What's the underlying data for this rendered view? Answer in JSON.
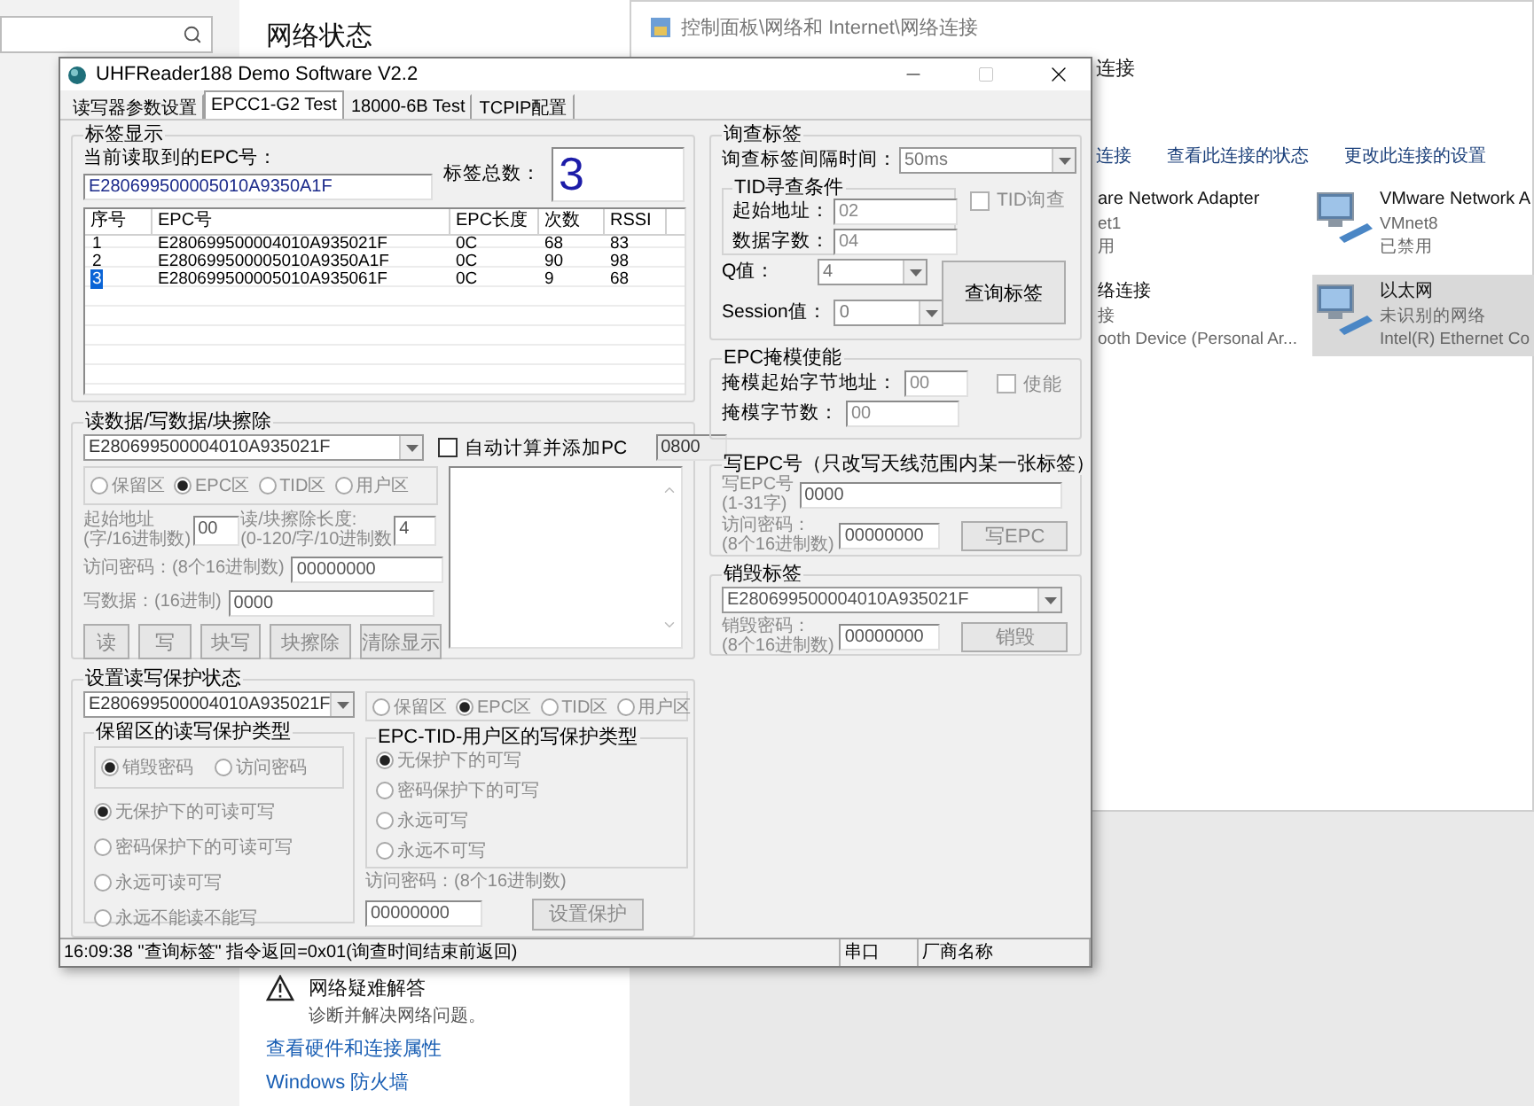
{
  "settings_window": {
    "heading": "网络状态",
    "troubleshoot": {
      "title": "网络疑难解答",
      "subtitle": "诊断并解决网络问题。"
    },
    "links": [
      "查看硬件和连接属性",
      "Windows 防火墙"
    ]
  },
  "network_window": {
    "path": "控制面板\\网络和 Internet\\网络连接",
    "address_tail": "连接",
    "toolbar": [
      "连接",
      "查看此连接的状态",
      "更改此连接的设置"
    ],
    "adapters": [
      {
        "lines": [
          "are Network Adapter",
          "et1",
          "用"
        ],
        "selected": false
      },
      {
        "lines": [
          "VMware Network A",
          "VMnet8",
          "已禁用"
        ],
        "selected": false
      },
      {
        "lines": [
          "络连接",
          "接",
          "ooth Device (Personal Ar..."
        ],
        "selected": false
      },
      {
        "lines": [
          "以太网",
          "未识别的网络",
          "Intel(R) Ethernet Co"
        ],
        "selected": true
      }
    ]
  },
  "app": {
    "title": "UHFReader188 Demo Software V2.2",
    "tabs": [
      {
        "label": "读写器参数设置",
        "selected": false
      },
      {
        "label": "EPCC1-G2 Test",
        "selected": true
      },
      {
        "label": "18000-6B Test",
        "selected": false
      },
      {
        "label": "TCPIP配置",
        "selected": false
      }
    ],
    "tag_display": {
      "title": "标签显示",
      "current_epc_label": "当前读取到的EPC号：",
      "current_epc": "E280699500005010A9350A1F",
      "total_label": "标签总数：",
      "total": "3",
      "columns": [
        "序号",
        "EPC号",
        "EPC长度",
        "次数",
        "RSSI"
      ],
      "rows": [
        {
          "cells": [
            "1",
            "E280699500004010A935021F",
            "0C",
            "68",
            "83"
          ],
          "selected": false
        },
        {
          "cells": [
            "2",
            "E280699500005010A9350A1F",
            "0C",
            "90",
            "98"
          ],
          "selected": false
        },
        {
          "cells": [
            "3",
            "E280699500005010A935061F",
            "0C",
            "9",
            "68"
          ],
          "selected": true
        }
      ]
    },
    "read_write": {
      "title": "读数据/写数据/块擦除",
      "disabled": true,
      "epc_select": "E280699500004010A935021F",
      "auto_pc": {
        "label": "自动计算并添加PC",
        "checked": false
      },
      "pc_value": "0800",
      "areas": [
        {
          "label": "保留区",
          "selected": false
        },
        {
          "label": "EPC区",
          "selected": true
        },
        {
          "label": "TID区",
          "selected": false
        },
        {
          "label": "用户区",
          "selected": false
        }
      ],
      "start_label": "起始地址\n(字/16进制数)",
      "start": "00",
      "length_label": "读/块擦除长度:\n(0-120/字/10进制数",
      "length": "4",
      "password_label": "访问密码：(8个16进制数)",
      "password": "00000000",
      "write_label": "写数据：(16进制)",
      "write_value": "0000",
      "buttons": [
        "读",
        "写",
        "块写",
        "块擦除",
        "清除显示"
      ]
    },
    "protection": {
      "title": "设置读写保护状态",
      "disabled": true,
      "epc_select": "E280699500004010A935021F",
      "areas": [
        {
          "label": "保留区",
          "selected": false
        },
        {
          "label": "EPC区",
          "selected": true
        },
        {
          "label": "TID区",
          "selected": false
        },
        {
          "label": "用户区",
          "selected": false
        }
      ],
      "reserved_title": "保留区的读写保护类型",
      "password_types": [
        {
          "label": "销毁密码",
          "selected": true
        },
        {
          "label": "访问密码",
          "selected": false
        }
      ],
      "reserved_modes": [
        {
          "label": "无保护下的可读可写",
          "selected": true
        },
        {
          "label": "密码保护下的可读可写",
          "selected": false
        },
        {
          "label": "永远可读可写",
          "selected": false
        },
        {
          "label": "永远不能读不能写",
          "selected": false
        }
      ],
      "write_title": "EPC-TID-用户区的写保护类型",
      "write_modes": [
        {
          "label": "无保护下的可写",
          "selected": true
        },
        {
          "label": "密码保护下的可写",
          "selected": false
        },
        {
          "label": "永远可写",
          "selected": false
        },
        {
          "label": "永远不可写",
          "selected": false
        }
      ],
      "password_label": "访问密码：(8个16进制数)",
      "password": "00000000",
      "button": "设置保护"
    },
    "inventory": {
      "title": "询查标签",
      "interval_label": "询查标签间隔时间：",
      "interval": "50ms",
      "tid_title": "TID寻查条件",
      "start_label": "起始地址：",
      "start": "02",
      "count_label": "数据字数：",
      "count": "04",
      "tid_check": {
        "label": "TID询查",
        "checked": false
      },
      "q_label": "Q值：",
      "q": "4",
      "session_label": "Session值：",
      "session": "0",
      "button": "查询标签"
    },
    "mask": {
      "title": "EPC掩模使能",
      "start_label": "掩模起始字节地址：",
      "start": "00",
      "enable": {
        "label": "使能",
        "checked": false
      },
      "count_label": "掩模字节数：",
      "count": "00"
    },
    "write_epc": {
      "title": "写EPC号（只改写天线范围内某一张标签）",
      "disabled": true,
      "epc_label": "写EPC号\n(1-31字)",
      "epc": "0000",
      "password_label": "访问密码：\n(8个16进制数)",
      "password": "00000000",
      "button": "写EPC"
    },
    "kill": {
      "title": "销毁标签",
      "disabled": true,
      "epc_select": "E280699500004010A935021F",
      "password_label": "销毁密码：\n(8个16进制数)",
      "password": "00000000",
      "button": "销毁"
    },
    "status_bar": [
      "16:09:38 \"查询标签\" 指令返回=0x01(询查时间结束前返回)",
      "串口",
      "厂商名称"
    ]
  }
}
